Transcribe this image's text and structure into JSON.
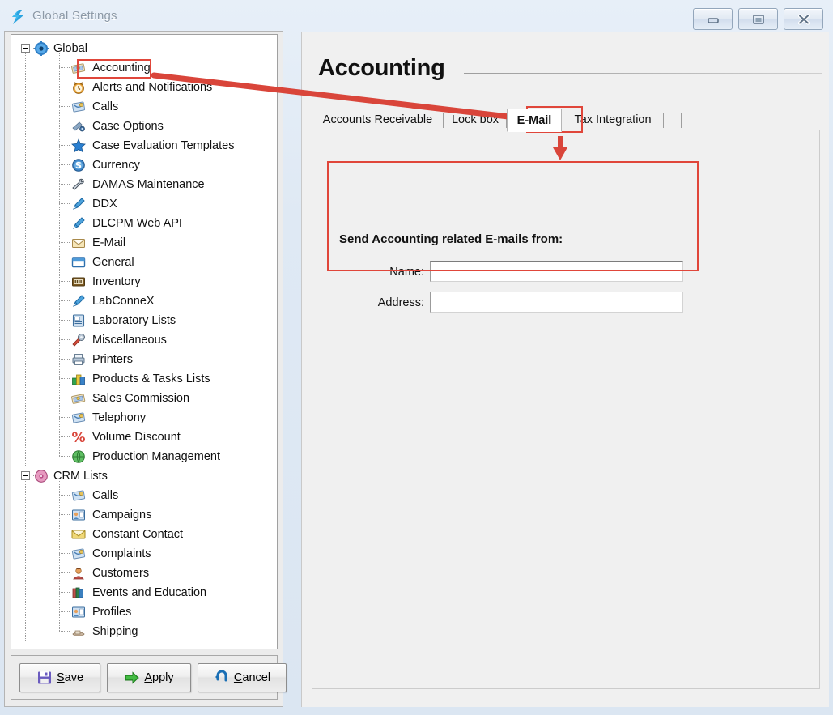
{
  "window": {
    "title": "Global Settings",
    "app_icon": "lightning-bolt-logo",
    "controls": {
      "minimize": "minimize-icon",
      "maximize": "maximize-icon",
      "close": "close-icon"
    }
  },
  "tree": {
    "nodes": [
      {
        "label": "Global",
        "level": 0,
        "icon": "gear-blue-icon",
        "expanded": true
      },
      {
        "label": "Accounting",
        "level": 1,
        "icon": "money-icon",
        "selected": true
      },
      {
        "label": "Alerts and Notifications",
        "level": 1,
        "icon": "alarm-clock-icon"
      },
      {
        "label": "Calls",
        "level": 1,
        "icon": "phone-note-icon"
      },
      {
        "label": "Case Options",
        "level": 1,
        "icon": "case-options-icon"
      },
      {
        "label": "Case Evaluation Templates",
        "level": 1,
        "icon": "blue-star-icon"
      },
      {
        "label": "Currency",
        "level": 1,
        "icon": "dollar-globe-icon"
      },
      {
        "label": "DAMAS Maintenance",
        "level": 1,
        "icon": "wrench-icon"
      },
      {
        "label": "DDX",
        "level": 1,
        "icon": "blue-pen-icon"
      },
      {
        "label": "DLCPM Web API",
        "level": 1,
        "icon": "blue-pen-icon"
      },
      {
        "label": "E-Mail",
        "level": 1,
        "icon": "envelope-icon"
      },
      {
        "label": "General",
        "level": 1,
        "icon": "window-icon"
      },
      {
        "label": "Inventory",
        "level": 1,
        "icon": "inventory-box-icon"
      },
      {
        "label": "LabConneX",
        "level": 1,
        "icon": "blue-pen-icon"
      },
      {
        "label": "Laboratory Lists",
        "level": 1,
        "icon": "clipboard-icon"
      },
      {
        "label": "Miscellaneous",
        "level": 1,
        "icon": "tools-icon"
      },
      {
        "label": "Printers",
        "level": 1,
        "icon": "printer-icon"
      },
      {
        "label": "Products & Tasks Lists",
        "level": 1,
        "icon": "colored-blocks-icon"
      },
      {
        "label": "Sales Commission",
        "level": 1,
        "icon": "money-icon"
      },
      {
        "label": "Telephony",
        "level": 1,
        "icon": "phone-note-icon"
      },
      {
        "label": "Volume Discount",
        "level": 1,
        "icon": "percent-icon"
      },
      {
        "label": "Production Management",
        "level": 1,
        "icon": "green-globe-icon"
      },
      {
        "label": "CRM Lists",
        "level": 0,
        "icon": "pink-disc-icon",
        "expanded": true
      },
      {
        "label": "Calls",
        "level": 1,
        "icon": "phone-note-icon"
      },
      {
        "label": "Campaigns",
        "level": 1,
        "icon": "people-card-icon"
      },
      {
        "label": "Constant Contact",
        "level": 1,
        "icon": "yellow-envelope-icon"
      },
      {
        "label": "Complaints",
        "level": 1,
        "icon": "phone-note-icon"
      },
      {
        "label": "Customers",
        "level": 1,
        "icon": "person-icon"
      },
      {
        "label": "Events and Education",
        "level": 1,
        "icon": "books-icon"
      },
      {
        "label": "Profiles",
        "level": 1,
        "icon": "people-card-icon"
      },
      {
        "label": "Shipping",
        "level": 1,
        "icon": "shipping-icon"
      }
    ]
  },
  "buttons": [
    {
      "label": "Save",
      "accel": "S",
      "icon": "floppy-disk-icon"
    },
    {
      "label": "Apply",
      "accel": "A",
      "icon": "green-arrow-icon"
    },
    {
      "label": "Cancel",
      "accel": "C",
      "icon": "undo-arrow-icon"
    }
  ],
  "content": {
    "page_title": "Accounting",
    "tabs": [
      {
        "label": "Accounts Receivable",
        "active": false
      },
      {
        "label": "Lock box",
        "active": false
      },
      {
        "label": "E-Mail",
        "active": true
      },
      {
        "label": "Tax Integration",
        "active": false
      }
    ],
    "group_label": "Send Accounting related E-mails from:",
    "fields": [
      {
        "label": "Name:",
        "value": "",
        "placeholder": ""
      },
      {
        "label": "Address:",
        "value": "",
        "placeholder": ""
      }
    ]
  },
  "annotations": {
    "color": "#e0463a",
    "boxes": [
      {
        "name": "accounting-tree-highlight"
      },
      {
        "name": "email-tab-highlight"
      },
      {
        "name": "email-form-highlight"
      }
    ],
    "arrows": [
      {
        "name": "tree-to-tab-arrow"
      },
      {
        "name": "tab-to-form-arrow"
      }
    ]
  }
}
